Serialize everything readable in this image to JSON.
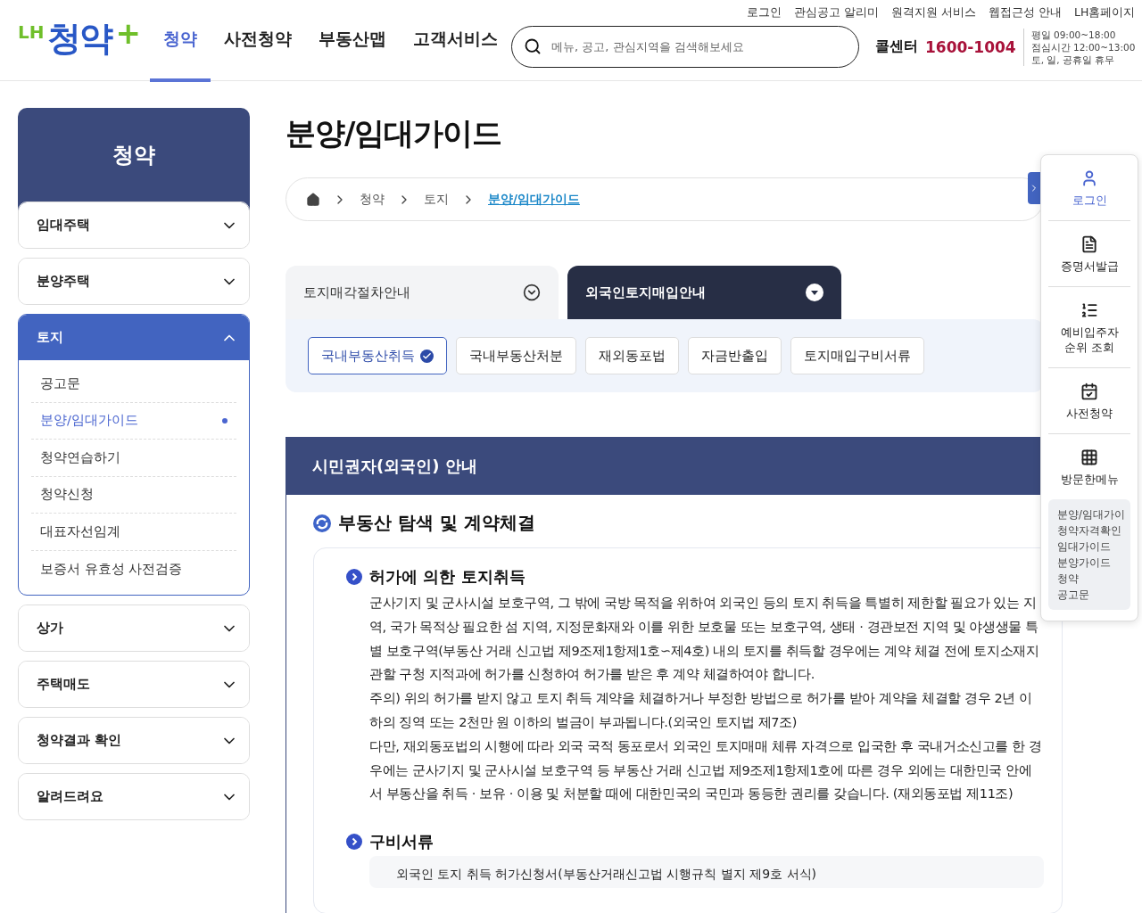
{
  "header": {
    "logo": {
      "prefix": "LH",
      "name": "청약",
      "plus": "+"
    },
    "utility_links": [
      "로그인",
      "관심공고 알리미",
      "원격지원 서비스",
      "웹접근성 안내",
      "LH홈페이지"
    ],
    "nav": [
      {
        "label": "청약",
        "selected": true
      },
      {
        "label": "사전청약",
        "selected": false
      },
      {
        "label": "부동산맵",
        "selected": false
      },
      {
        "label": "고객서비스",
        "selected": false
      }
    ],
    "search": {
      "placeholder": "메뉴, 공고, 관심지역을 검색해보세요"
    },
    "call_center": {
      "label": "콜센터",
      "number": "1600-1004",
      "hours": [
        "평일 09:00~18:00",
        "점심시간 12:00~13:00",
        "토, 일, 공휴일 휴무"
      ]
    }
  },
  "sidebar": {
    "title": "청약",
    "groups": [
      {
        "label": "임대주택",
        "expanded": false
      },
      {
        "label": "분양주택",
        "expanded": false
      },
      {
        "label": "토지",
        "expanded": true,
        "children": [
          {
            "label": "공고문",
            "selected": false
          },
          {
            "label": "분양/임대가이드",
            "selected": true
          },
          {
            "label": "청약연습하기",
            "selected": false
          },
          {
            "label": "청약신청",
            "selected": false
          },
          {
            "label": "대표자선임계",
            "selected": false
          },
          {
            "label": "보증서 유효성 사전검증",
            "selected": false
          }
        ]
      },
      {
        "label": "상가",
        "expanded": false
      },
      {
        "label": "주택매도",
        "expanded": false
      },
      {
        "label": "청약결과 확인",
        "expanded": false
      },
      {
        "label": "알려드려요",
        "expanded": false
      }
    ]
  },
  "page_title": "분양/임대가이드",
  "breadcrumb": [
    "청약",
    "토지",
    "분양/임대가이드"
  ],
  "tabs": [
    {
      "label": "토지매각절차안내",
      "selected": false
    },
    {
      "label": "외국인토지매입안내",
      "selected": true
    }
  ],
  "sub_tabs": [
    {
      "label": "국내부동산취득",
      "selected": true
    },
    {
      "label": "국내부동산처분",
      "selected": false
    },
    {
      "label": "재외동포법",
      "selected": false
    },
    {
      "label": "자금반출입",
      "selected": false
    },
    {
      "label": "토지매입구비서류",
      "selected": false
    }
  ],
  "section": {
    "title": "시민권자(외국인) 안내",
    "heading": "부동산 탐색 및 계약체결",
    "blocks": [
      {
        "title": "허가에 의한 토지취득",
        "paragraphs": [
          "군사기지 및 군사시설 보호구역, 그 밖에 국방 목적을 위하여 외국인 등의 토지 취득을 특별히 제한할 필요가 있는 지역, 국가 목적상 필요한 섬 지역, 지정문화재와 이를 위한 보호물 또는 보호구역, 생태 · 경관보전 지역 및 야생생물 특별 보호구역(부동산 거래 신고법 제9조제1항제1호∽제4호) 내의 토지를 취득할 경우에는 계약 체결 전에 토지소재지 관할 구청 지적과에 허가를 신청하여 허가를 받은 후 계약 체결하여야 합니다.",
          "주의) 위의 허가를 받지 않고 토지 취득 계약을 체결하거나 부정한 방법으로 허가를 받아 계약을 체결할 경우 2년 이하의 징역 또는 2천만 원 이하의 벌금이 부과됩니다.(외국인 토지법 제7조)",
          "다만, 재외동포법의 시행에 따라 외국 국적 동포로서 외국인 토지매매 체류 자격으로 입국한 후 국내거소신고를 한 경우에는 군사기지 및 군사시설 보호구역 등 부동산 거래 신고법 제9조제1항제1호에 따른 경우 외에는 대한민국 안에서 부동산을 취득 · 보유 · 이용 및 처분할 때에 대한민국의 국민과 동등한 권리를 갖습니다. (재외동포법 제11조)"
        ]
      },
      {
        "title": "구비서류",
        "items": [
          "외국인 토지 취득 허가신청서(부동산거래신고법 시행규칙 별지 제9호 서식)"
        ]
      }
    ]
  },
  "quick_menu": {
    "items": [
      {
        "kind": "user",
        "label": "로그인",
        "selected": true
      },
      {
        "kind": "document",
        "label": "증명서발급",
        "selected": false
      },
      {
        "kind": "list",
        "label": "예비입주자 순위 조회",
        "selected": false
      },
      {
        "kind": "calendar",
        "label": "사전청약",
        "selected": false
      },
      {
        "kind": "grid",
        "label": "방문한메뉴",
        "selected": false
      }
    ],
    "recent": [
      "분양/임대가이",
      "청약자격확인",
      "임대가이드",
      "분양가이드",
      "청약",
      "공고문"
    ]
  }
}
